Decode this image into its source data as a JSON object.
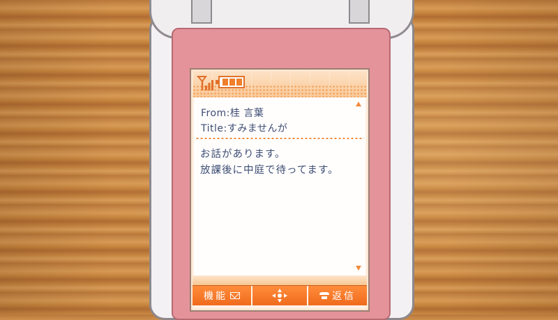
{
  "message": {
    "from_label": "From:",
    "from_value": "桂 言葉",
    "title_label": "Title:",
    "title_value": "すみませんが",
    "body_lines": [
      "お話があります。",
      "放課後に中庭で待ってます。"
    ]
  },
  "softkeys": {
    "left_label": "機能",
    "right_label": "返信"
  },
  "status": {
    "battery_level_fraction": 1.0,
    "signal_icon": "signal-antenna-icon"
  },
  "colors": {
    "accent": "#f06a1d",
    "text": "#3e4d73",
    "phone_pink": "#e4939b"
  }
}
